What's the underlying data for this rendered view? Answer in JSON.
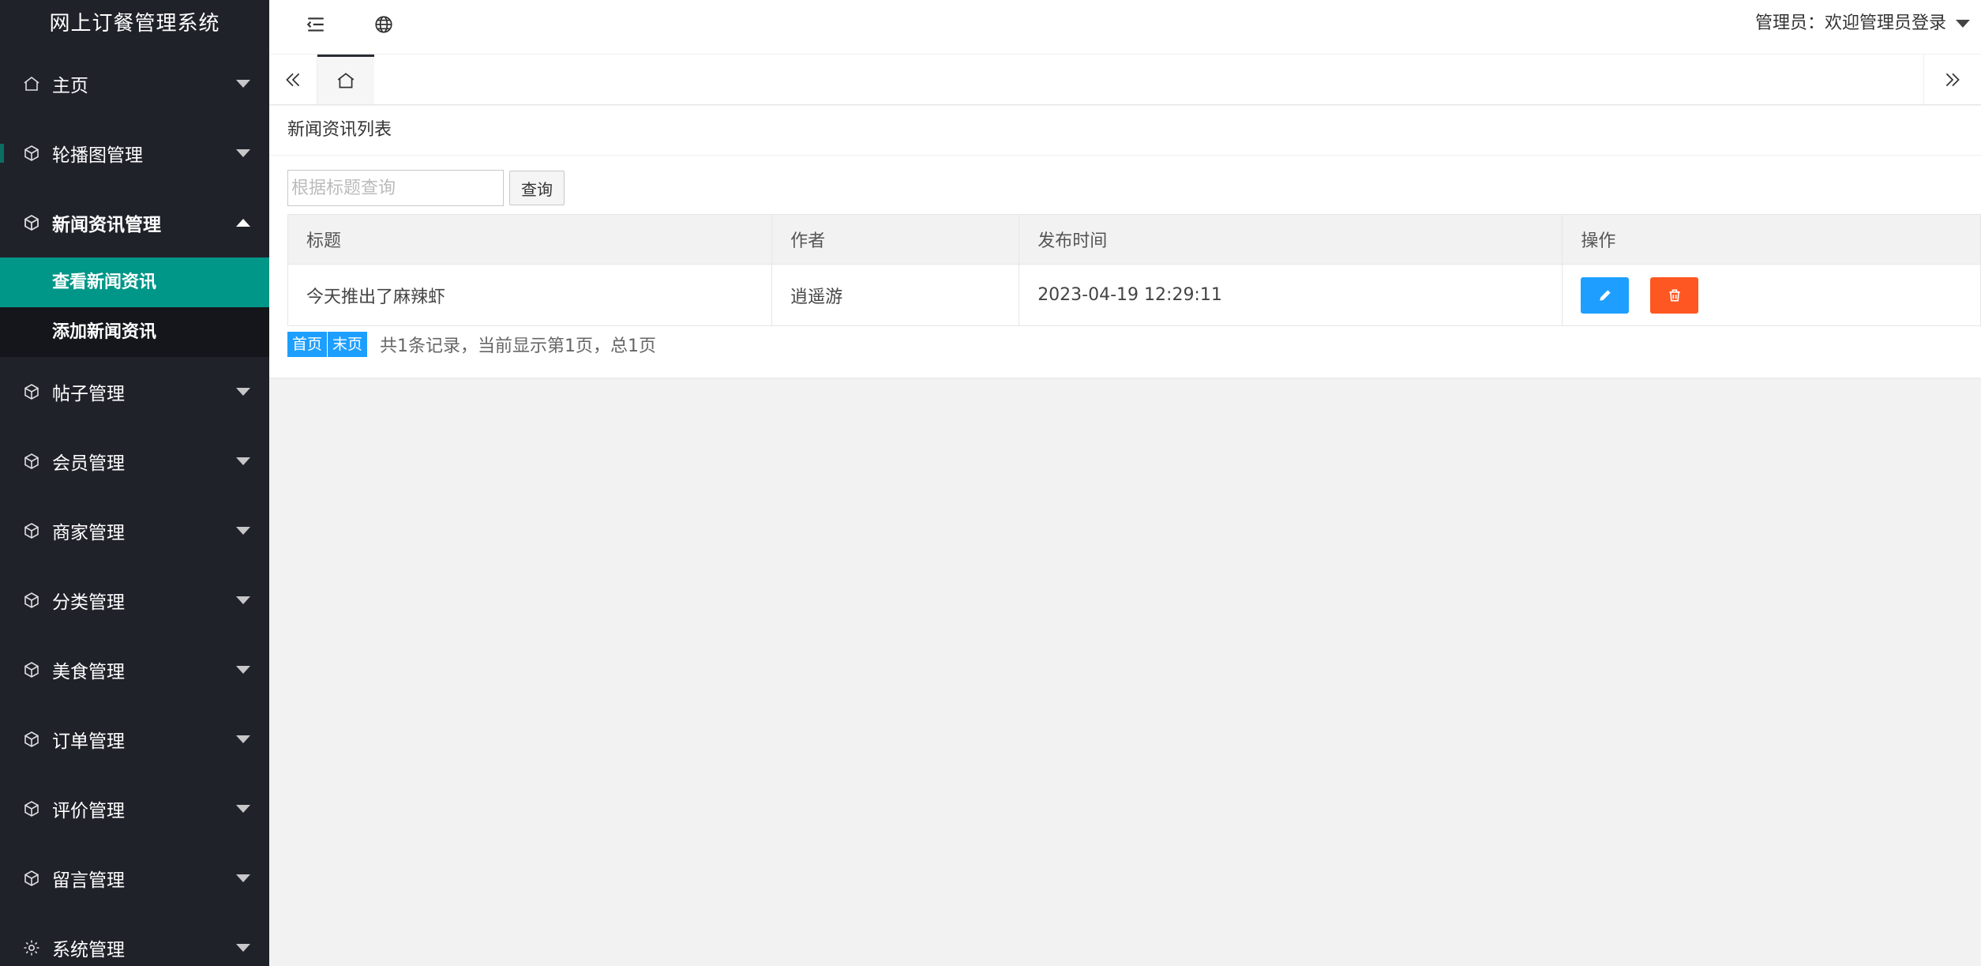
{
  "app": {
    "title": "网上订餐管理系统"
  },
  "sidebar": {
    "items": [
      {
        "label": "主页",
        "icon": "home-icon"
      },
      {
        "label": "轮播图管理",
        "icon": "cube-icon"
      },
      {
        "label": "新闻资讯管理",
        "icon": "cube-icon",
        "open": true,
        "children": [
          {
            "label": "查看新闻资讯",
            "active": true
          },
          {
            "label": "添加新闻资讯"
          }
        ]
      },
      {
        "label": "帖子管理",
        "icon": "cube-icon"
      },
      {
        "label": "会员管理",
        "icon": "cube-icon"
      },
      {
        "label": "商家管理",
        "icon": "cube-icon"
      },
      {
        "label": "分类管理",
        "icon": "cube-icon"
      },
      {
        "label": "美食管理",
        "icon": "cube-icon"
      },
      {
        "label": "订单管理",
        "icon": "cube-icon"
      },
      {
        "label": "评价管理",
        "icon": "cube-icon"
      },
      {
        "label": "留言管理",
        "icon": "cube-icon"
      },
      {
        "label": "系统管理",
        "icon": "gear-icon"
      }
    ]
  },
  "header": {
    "user_text": "管理员：欢迎管理员登录"
  },
  "card": {
    "title": "新闻资讯列表",
    "search": {
      "placeholder": "根据标题查询",
      "value": "",
      "button": "查询"
    },
    "table": {
      "columns": [
        "标题",
        "作者",
        "发布时间",
        "操作"
      ],
      "rows": [
        {
          "title": "今天推出了麻辣虾",
          "author": "逍遥游",
          "time": "2023-04-19 12:29:11"
        }
      ]
    },
    "pager": {
      "first": "首页",
      "last": "末页",
      "info": "共1条记录，当前显示第1页，总1页"
    }
  },
  "colors": {
    "sidebar_bg": "#20222a",
    "active": "#009688",
    "edit": "#1e9fff",
    "delete": "#ff5722"
  }
}
